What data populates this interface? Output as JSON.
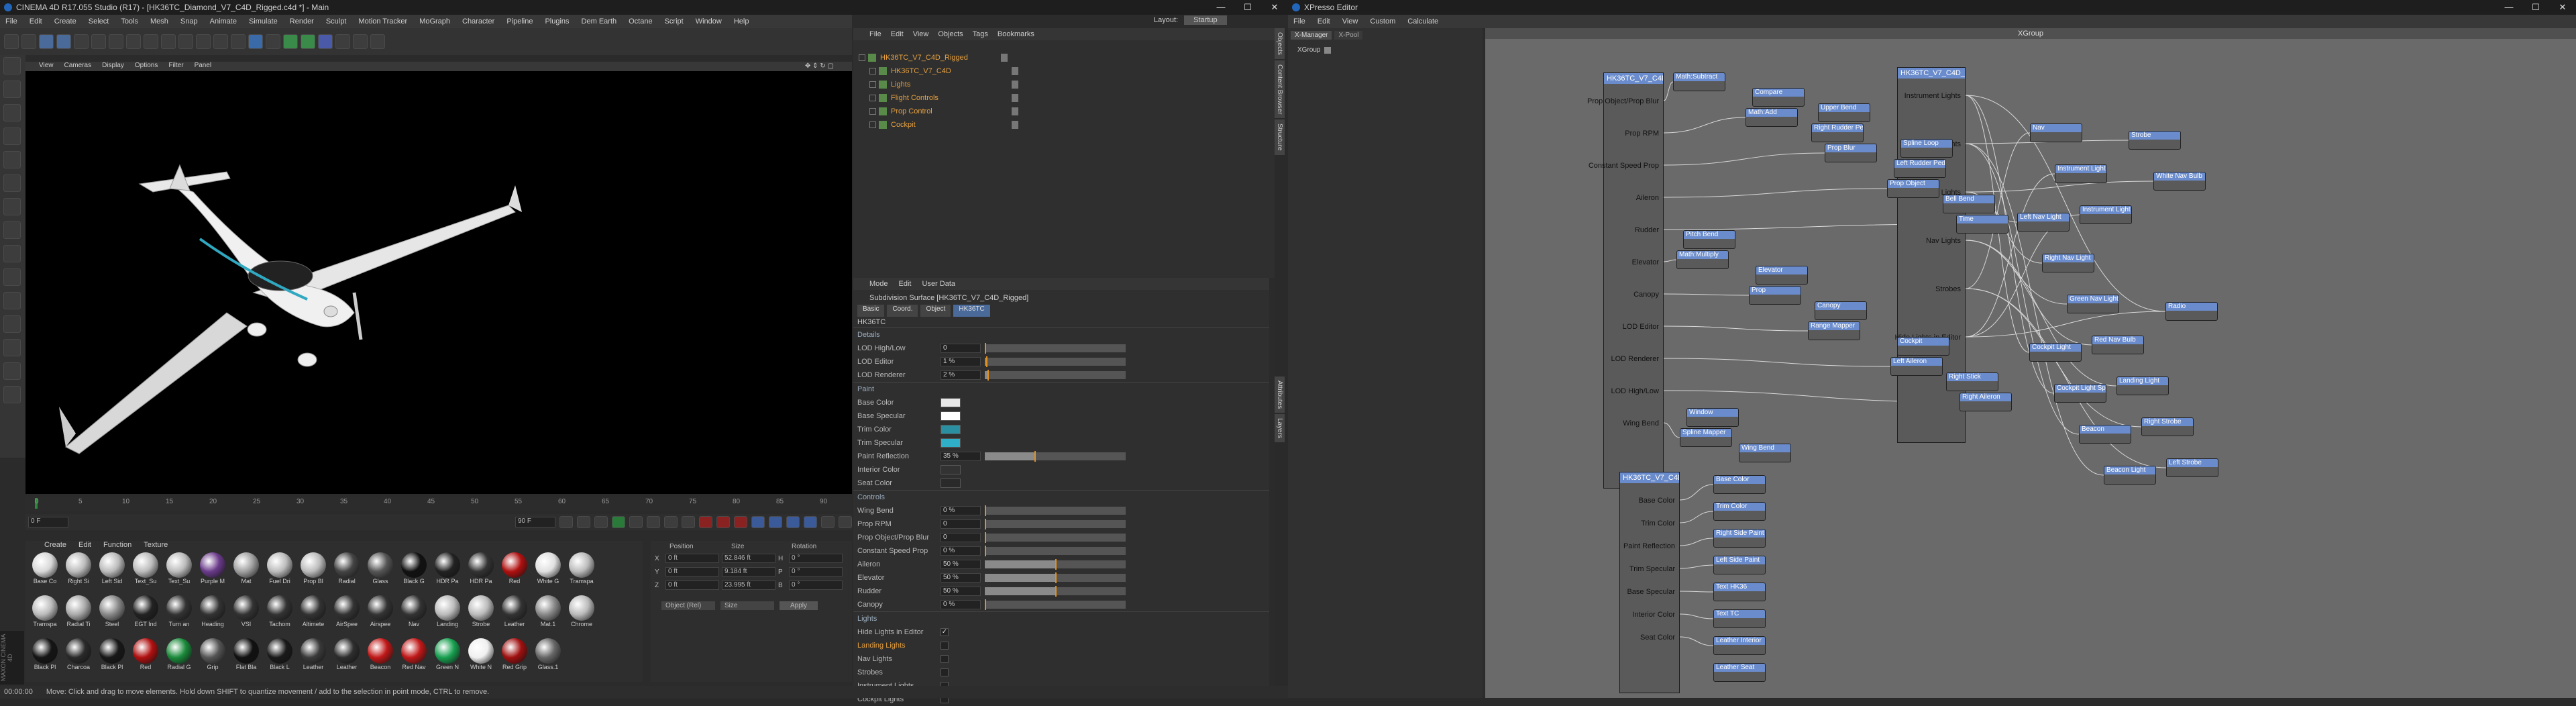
{
  "main_window": {
    "title": "CINEMA 4D R17.055 Studio (R17) - [HK36TC_Diamond_V7_C4D_Rigged.c4d *] - Main",
    "menu": [
      "File",
      "Edit",
      "Create",
      "Select",
      "Tools",
      "Mesh",
      "Snap",
      "Animate",
      "Simulate",
      "Render",
      "Sculpt",
      "Motion Tracker",
      "MoGraph",
      "Character",
      "Pipeline",
      "Plugins",
      "Dem Earth",
      "Octane",
      "Script",
      "Window",
      "Help"
    ],
    "layout_label": "Layout:",
    "layout_value": "Startup",
    "viewport_menu": [
      "View",
      "Cameras",
      "Display",
      "Options",
      "Filter",
      "Panel"
    ]
  },
  "object_manager": {
    "menu": [
      "File",
      "Edit",
      "View",
      "Objects",
      "Tags",
      "Bookmarks"
    ],
    "objects": [
      {
        "name": "HK36TC_V7_C4D_Rigged",
        "indent": 0
      },
      {
        "name": "HK36TC_V7_C4D",
        "indent": 1
      },
      {
        "name": "Lights",
        "indent": 1
      },
      {
        "name": "Flight Controls",
        "indent": 1
      },
      {
        "name": "Prop Control",
        "indent": 1
      },
      {
        "name": "Cockpit",
        "indent": 1
      }
    ]
  },
  "attributes": {
    "menu": [
      "Mode",
      "Edit",
      "User Data"
    ],
    "object_title": "Subdivision Surface [HK36TC_V7_C4D_Rigged]",
    "tabs": [
      "Basic",
      "Coord.",
      "Object",
      "HK36TC"
    ],
    "group_title": "HK36TC",
    "details_header": "Details",
    "details": [
      {
        "label": "LOD High/Low",
        "value": "0",
        "fill": 0
      },
      {
        "label": "LOD Editor",
        "value": "1 %",
        "fill": 0.01
      },
      {
        "label": "LOD Renderer",
        "value": "2 %",
        "fill": 0.02
      }
    ],
    "paint_header": "Paint",
    "paint": [
      {
        "label": "Base Color",
        "color": "#e8e8e8"
      },
      {
        "label": "Base Specular",
        "color": "#ffffff"
      },
      {
        "label": "Trim Color",
        "color": "#2a8fa0"
      },
      {
        "label": "Trim Specular",
        "color": "#30b0c8"
      },
      {
        "label": "Paint Reflection",
        "value": "35 %",
        "fill": 0.35
      },
      {
        "label": "Interior Color",
        "color": "#333333"
      },
      {
        "label": "Seat Color",
        "color": "#2a2a2a"
      }
    ],
    "controls_header": "Controls",
    "controls": [
      {
        "label": "Wing Bend",
        "value": "0 %",
        "fill": 0
      },
      {
        "label": "Prop RPM",
        "value": "0",
        "fill": 0
      },
      {
        "label": "Prop Object/Prop Blur",
        "value": "0",
        "fill": 0
      },
      {
        "label": "Constant Speed Prop",
        "value": "0 %",
        "fill": 0
      },
      {
        "label": "Aileron",
        "value": "50 %",
        "fill": 0.5
      },
      {
        "label": "Elevator",
        "value": "50 %",
        "fill": 0.5
      },
      {
        "label": "Rudder",
        "value": "50 %",
        "fill": 0.5
      },
      {
        "label": "Canopy",
        "value": "0 %",
        "fill": 0
      }
    ],
    "lights_header": "Lights",
    "lights": [
      {
        "label": "Hide Lights in Editor",
        "checked": true
      },
      {
        "label": "Landing Lights",
        "checked": false
      },
      {
        "label": "Nav Lights",
        "checked": false
      },
      {
        "label": "Strobes",
        "checked": false
      },
      {
        "label": "Instrument Lights",
        "checked": false
      },
      {
        "label": "Cockpit Lights",
        "checked": false
      }
    ]
  },
  "timeline": {
    "ticks": [
      "0",
      "5",
      "10",
      "15",
      "20",
      "25",
      "30",
      "35",
      "40",
      "45",
      "50",
      "55",
      "60",
      "65",
      "70",
      "75",
      "80",
      "85",
      "90"
    ],
    "start_frame": "0 F",
    "end_frame": "90 F",
    "current_frame": "0 F"
  },
  "material_manager": {
    "menu": [
      "Create",
      "Edit",
      "Function",
      "Texture"
    ],
    "materials": [
      {
        "name": "Base Co",
        "color": "#d8d8d8"
      },
      {
        "name": "Right Si",
        "color": "#bbbbbb"
      },
      {
        "name": "Left Sid",
        "color": "#bbbbbb"
      },
      {
        "name": "Text_Su",
        "color": "#bbbbbb"
      },
      {
        "name": "Text_Su",
        "color": "#bbbbbb"
      },
      {
        "name": "Purple M",
        "color": "#6a3a8a"
      },
      {
        "name": "Mat",
        "color": "#a0a0a0"
      },
      {
        "name": "Fuel Dri",
        "color": "#bbbbbb"
      },
      {
        "name": "Prop Bl",
        "color": "#bbbbbb"
      },
      {
        "name": "Radial",
        "color": "#444444"
      },
      {
        "name": "Glass",
        "color": "#555555"
      },
      {
        "name": "Black G",
        "color": "#111111"
      },
      {
        "name": "HDR Pa",
        "color": "#222222"
      },
      {
        "name": "HDR Pa",
        "color": "#333333"
      },
      {
        "name": "Red",
        "color": "#b01010"
      },
      {
        "name": "White G",
        "color": "#e0e0e0"
      },
      {
        "name": "Tramspa",
        "color": "#bbbbbb"
      },
      {
        "name": "Tramspa",
        "color": "#bbbbbb"
      },
      {
        "name": "Radial Ti",
        "color": "#aaaaaa"
      },
      {
        "name": "Steel",
        "color": "#888888"
      },
      {
        "name": "EGT Ind",
        "color": "#222222"
      },
      {
        "name": "Turn an",
        "color": "#333333"
      },
      {
        "name": "Heading",
        "color": "#333333"
      },
      {
        "name": "VSI",
        "color": "#333333"
      },
      {
        "name": "Tachom",
        "color": "#333333"
      },
      {
        "name": "Altimete",
        "color": "#333333"
      },
      {
        "name": "AirSpee",
        "color": "#333333"
      },
      {
        "name": "Airspee",
        "color": "#333333"
      },
      {
        "name": "Nav",
        "color": "#333333"
      },
      {
        "name": "Landing",
        "color": "#bbbbbb"
      },
      {
        "name": "Strobe",
        "color": "#bbbbbb"
      },
      {
        "name": "Leather",
        "color": "#333333"
      },
      {
        "name": "Mat.1",
        "color": "#888888"
      },
      {
        "name": "Chrome",
        "color": "#bbbbbb"
      },
      {
        "name": "Black Pl",
        "color": "#151515"
      },
      {
        "name": "Charcoa",
        "color": "#2a2a2a"
      },
      {
        "name": "Black Pl",
        "color": "#181818"
      },
      {
        "name": "Red",
        "color": "#b01010"
      },
      {
        "name": "Radial G",
        "color": "#1a8a3a"
      },
      {
        "name": "Grip",
        "color": "#555555"
      },
      {
        "name": "Flat Bla",
        "color": "#111111"
      },
      {
        "name": "Black L",
        "color": "#1a1a1a"
      },
      {
        "name": "Leather",
        "color": "#3a3a3a"
      },
      {
        "name": "Leather",
        "color": "#2e2e2e"
      },
      {
        "name": "Beacon",
        "color": "#c01818"
      },
      {
        "name": "Red Nav",
        "color": "#c01818"
      },
      {
        "name": "Green N",
        "color": "#18a050"
      },
      {
        "name": "White N",
        "color": "#f0f0f0"
      },
      {
        "name": "Red Grip",
        "color": "#a01010"
      },
      {
        "name": "Glass.1",
        "color": "#666666"
      }
    ]
  },
  "coordinates": {
    "headers": [
      "Position",
      "Size",
      "Rotation"
    ],
    "rows": [
      {
        "axis": "X",
        "pos": "0 ft",
        "size": "52.846 ft",
        "rot_axis": "H",
        "rot": "0 °"
      },
      {
        "axis": "Y",
        "pos": "0 ft",
        "size": "9.184 ft",
        "rot_axis": "P",
        "rot": "0 °"
      },
      {
        "axis": "Z",
        "pos": "0 ft",
        "size": "23.995 ft",
        "rot_axis": "B",
        "rot": "0 °"
      }
    ],
    "mode": "Object (Rel)",
    "size_mode": "Size",
    "apply": "Apply"
  },
  "status": {
    "time": "00:00:00",
    "message": "Move: Click and drag to move elements. Hold down SHIFT to quantize movement / add to the selection in point mode, CTRL to remove."
  },
  "xpresso": {
    "title": "XPresso Editor",
    "menu": [
      "File",
      "Edit",
      "View",
      "Custom",
      "Calculate"
    ],
    "tabs": [
      "X-Manager",
      "X-Pool"
    ],
    "group_tab": "XGroup",
    "canvas_title": "XGroup",
    "main_node": {
      "title": "HK36TC_V7_C4D_Rig",
      "ports": [
        "Prop Object/Prop Blur",
        "Prop RPM",
        "Constant Speed Prop",
        "Aileron",
        "Rudder",
        "Elevator",
        "Canopy",
        "LOD Editor",
        "LOD Renderer",
        "LOD High/Low",
        "Wing Bend"
      ]
    },
    "paint_node": {
      "title": "HK36TC_V7_C4D_Rig",
      "ports": [
        "Base Color",
        "Trim Color",
        "Paint Reflection",
        "Trim Specular",
        "Base Specular",
        "Interior Color",
        "Seat Color"
      ]
    },
    "lights_node": {
      "title": "HK36TC_V7_C4D_Rig",
      "ports": [
        "Instrument Lights",
        "Cockpit Lights",
        "Landing Lights",
        "Nav Lights",
        "Strobes",
        "Hide Lights in Editor"
      ]
    },
    "small_nodes": [
      "Math:Subtract",
      "Math:Add",
      "Prop Blur",
      "Prop Object",
      "Time",
      "Math:Multiply",
      "Prop",
      "Range Mapper",
      "Left Aileron",
      "Right Aileron",
      "Spline Mapper",
      "Compare",
      "Right Rudder Pedal",
      "Left Rudder Pedal",
      "Bell Bend",
      "Pitch Bend",
      "Elevator",
      "Canopy",
      "Cockpit",
      "Right Stick",
      "Window",
      "Wing Bend",
      "Upper Bend",
      "Spline Loop",
      "Base Color",
      "Trim Color",
      "Right Side Paint",
      "Left Side Paint",
      "Text HK36",
      "Text TC",
      "Leather Interior",
      "Leather Seat",
      "Radio",
      "Cockpit Light",
      "Cockpit Light Sp",
      "Beacon",
      "Beacon Light",
      "Strobe",
      "White Nav Bulb",
      "Left Nav Light",
      "Right Nav Light",
      "Green Nav Light",
      "Red Nav Bulb",
      "Landing Light",
      "Right Strobe",
      "Left Strobe",
      "Nav",
      "Instrument Light",
      "Instrument Light Sp"
    ]
  },
  "palette": {
    "accent_blue": "#6a8ccc",
    "object_orange": "#e6a040",
    "timeline_marker": "#e09020"
  }
}
